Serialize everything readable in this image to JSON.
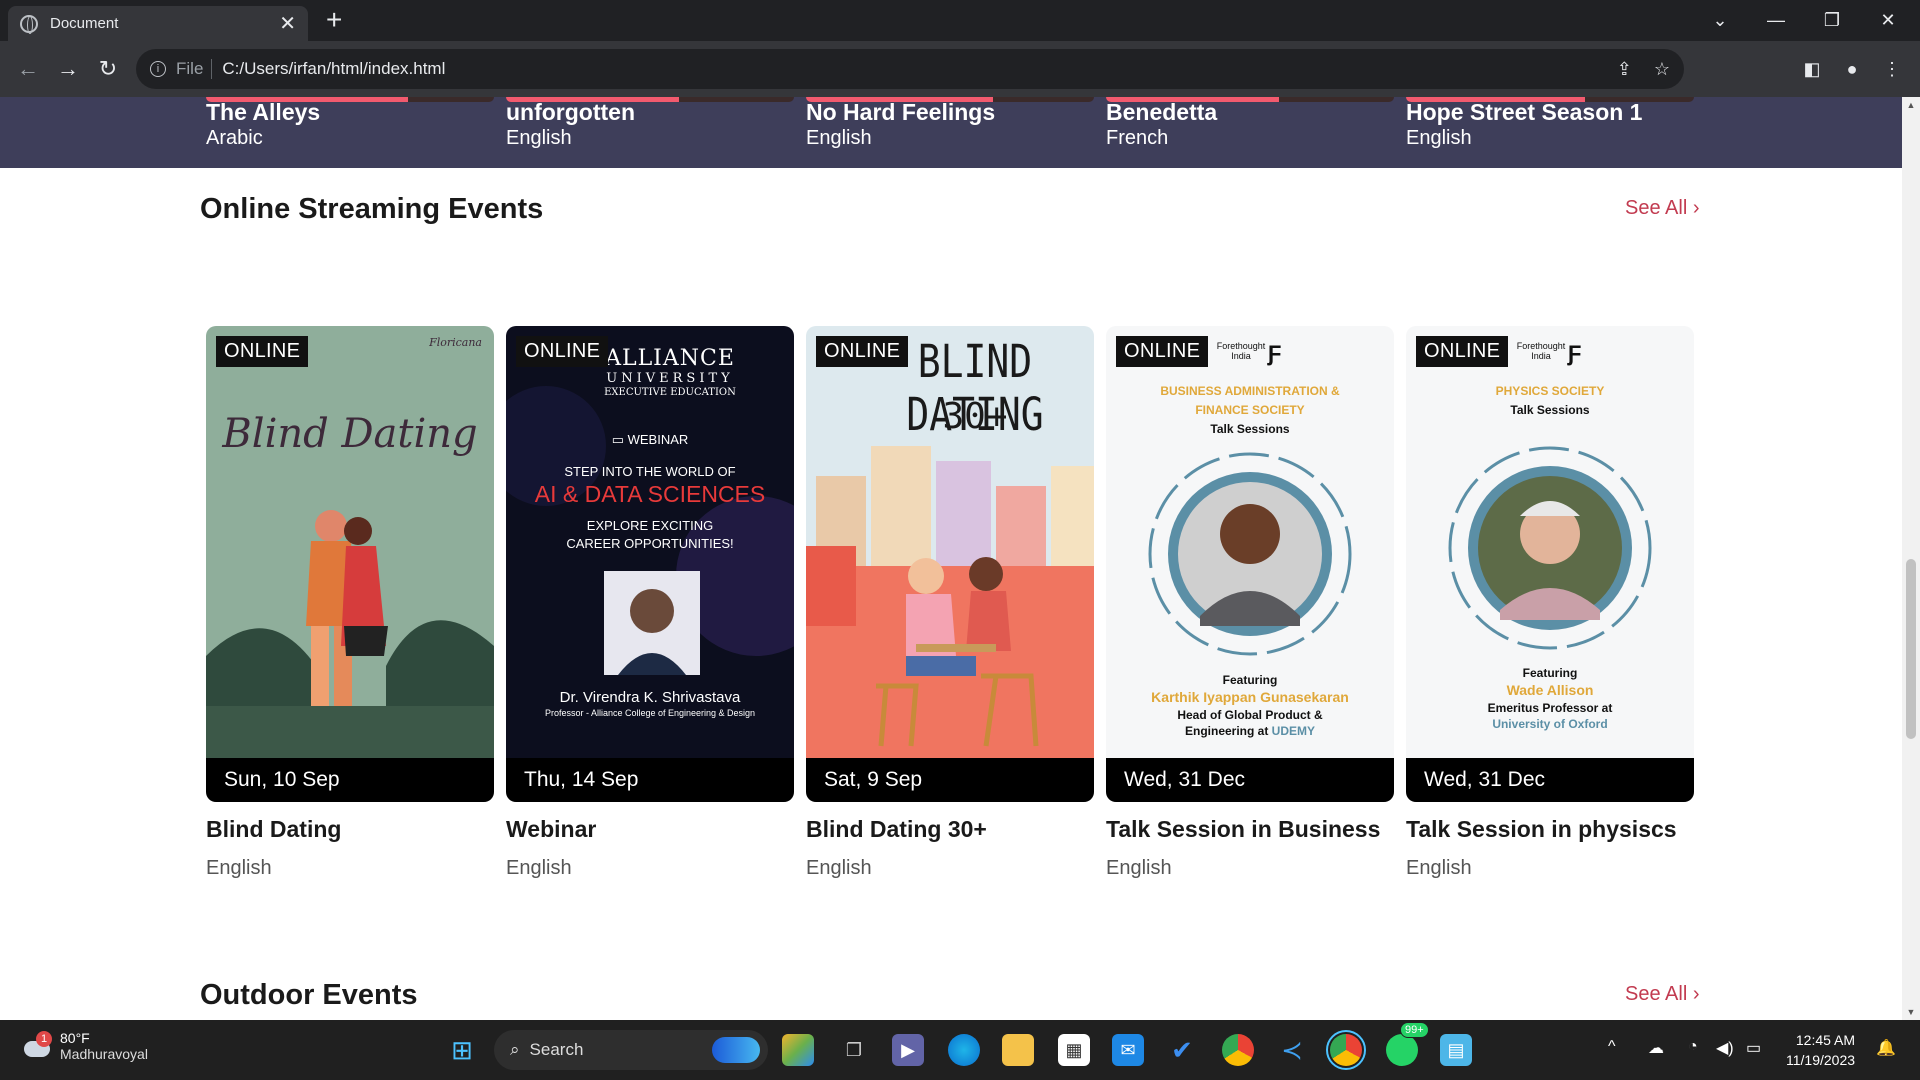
{
  "browser": {
    "tab_title": "Document",
    "url_scheme": "File",
    "url": "C:/Users/irfan/html/index.html"
  },
  "recommended": [
    {
      "title": "The Alleys",
      "language": "Arabic"
    },
    {
      "title": "unforgotten",
      "language": "English"
    },
    {
      "title": "No Hard Feelings",
      "language": "English"
    },
    {
      "title": "Benedetta",
      "language": "French"
    },
    {
      "title": "Hope Street Season 1",
      "language": "English"
    }
  ],
  "online_section": {
    "title": "Online Streaming Events",
    "see_all": "See All",
    "events": [
      {
        "badge": "ONLINE",
        "date": "Sun, 10 Sep",
        "title": "Blind Dating",
        "language": "English",
        "poster": {
          "script": "Blind Dating",
          "brand": "Floricana"
        }
      },
      {
        "badge": "ONLINE",
        "date": "Thu, 14 Sep",
        "title": "Webinar",
        "language": "English",
        "poster": {
          "org": "ALLIANCE",
          "org2": "UNIVERSITY",
          "org3": "EXECUTIVE EDUCATION",
          "kind": "WEBINAR",
          "line1": "STEP INTO THE WORLD OF",
          "headline": "AI & DATA SCIENCES",
          "line2": "EXPLORE EXCITING",
          "line3": "CAREER OPPORTUNITIES!",
          "speaker": "Dr. Virendra K. Shrivastava",
          "role": "Professor - Alliance College of Engineering & Design"
        }
      },
      {
        "badge": "ONLINE",
        "date": "Sat, 9 Sep",
        "title": "Blind Dating 30+",
        "language": "English",
        "poster": {
          "line1": "BLIND DATING",
          "line2": "30+"
        }
      },
      {
        "badge": "ONLINE",
        "date": "Wed, 31 Dec",
        "title": "Talk Session in Business",
        "language": "English",
        "poster": {
          "brand": "Forethought India",
          "society1": "BUSINESS ADMINISTRATION &",
          "society2": "FINANCE SOCIETY",
          "sub": "Talk Sessions",
          "featuring": "Featuring",
          "speaker": "Karthik Iyappan Gunasekaran",
          "role1": "Head of Global Product &",
          "role2": "Engineering at",
          "org": "UDEMY"
        }
      },
      {
        "badge": "ONLINE",
        "date": "Wed, 31 Dec",
        "title": "Talk Session in physiscs",
        "language": "English",
        "poster": {
          "brand": "Forethought India",
          "society1": "PHYSICS SOCIETY",
          "sub": "Talk Sessions",
          "featuring": "Featuring",
          "speaker": "Wade Allison",
          "role1": "Emeritus Professor at",
          "org": "University of Oxford"
        }
      }
    ]
  },
  "outdoor_section": {
    "title": "Outdoor Events",
    "see_all": "See All"
  },
  "taskbar": {
    "temperature": "80°F",
    "location": "Madhuravoyal",
    "weather_badge": "1",
    "search_label": "Search",
    "whatsapp_badge": "99+",
    "time": "12:45 AM",
    "date": "11/19/2023"
  },
  "colors": {
    "accent": "#c23b50",
    "recommended_bg": "#3e3e5a",
    "tab_bg": "#35363a",
    "taskbar_bg": "#202020"
  }
}
